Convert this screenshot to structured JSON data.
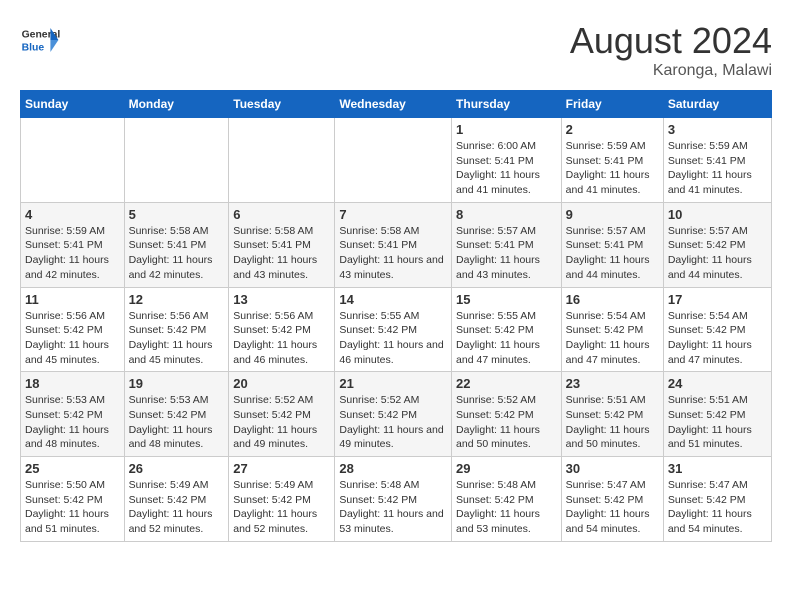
{
  "header": {
    "logo_line1": "General",
    "logo_line2": "Blue",
    "title": "August 2024",
    "subtitle": "Karonga, Malawi"
  },
  "days_of_week": [
    "Sunday",
    "Monday",
    "Tuesday",
    "Wednesday",
    "Thursday",
    "Friday",
    "Saturday"
  ],
  "weeks": [
    [
      {
        "day": "",
        "sunrise": "",
        "sunset": "",
        "daylight": ""
      },
      {
        "day": "",
        "sunrise": "",
        "sunset": "",
        "daylight": ""
      },
      {
        "day": "",
        "sunrise": "",
        "sunset": "",
        "daylight": ""
      },
      {
        "day": "",
        "sunrise": "",
        "sunset": "",
        "daylight": ""
      },
      {
        "day": "1",
        "sunrise": "Sunrise: 6:00 AM",
        "sunset": "Sunset: 5:41 PM",
        "daylight": "Daylight: 11 hours and 41 minutes."
      },
      {
        "day": "2",
        "sunrise": "Sunrise: 5:59 AM",
        "sunset": "Sunset: 5:41 PM",
        "daylight": "Daylight: 11 hours and 41 minutes."
      },
      {
        "day": "3",
        "sunrise": "Sunrise: 5:59 AM",
        "sunset": "Sunset: 5:41 PM",
        "daylight": "Daylight: 11 hours and 41 minutes."
      }
    ],
    [
      {
        "day": "4",
        "sunrise": "Sunrise: 5:59 AM",
        "sunset": "Sunset: 5:41 PM",
        "daylight": "Daylight: 11 hours and 42 minutes."
      },
      {
        "day": "5",
        "sunrise": "Sunrise: 5:58 AM",
        "sunset": "Sunset: 5:41 PM",
        "daylight": "Daylight: 11 hours and 42 minutes."
      },
      {
        "day": "6",
        "sunrise": "Sunrise: 5:58 AM",
        "sunset": "Sunset: 5:41 PM",
        "daylight": "Daylight: 11 hours and 43 minutes."
      },
      {
        "day": "7",
        "sunrise": "Sunrise: 5:58 AM",
        "sunset": "Sunset: 5:41 PM",
        "daylight": "Daylight: 11 hours and 43 minutes."
      },
      {
        "day": "8",
        "sunrise": "Sunrise: 5:57 AM",
        "sunset": "Sunset: 5:41 PM",
        "daylight": "Daylight: 11 hours and 43 minutes."
      },
      {
        "day": "9",
        "sunrise": "Sunrise: 5:57 AM",
        "sunset": "Sunset: 5:41 PM",
        "daylight": "Daylight: 11 hours and 44 minutes."
      },
      {
        "day": "10",
        "sunrise": "Sunrise: 5:57 AM",
        "sunset": "Sunset: 5:42 PM",
        "daylight": "Daylight: 11 hours and 44 minutes."
      }
    ],
    [
      {
        "day": "11",
        "sunrise": "Sunrise: 5:56 AM",
        "sunset": "Sunset: 5:42 PM",
        "daylight": "Daylight: 11 hours and 45 minutes."
      },
      {
        "day": "12",
        "sunrise": "Sunrise: 5:56 AM",
        "sunset": "Sunset: 5:42 PM",
        "daylight": "Daylight: 11 hours and 45 minutes."
      },
      {
        "day": "13",
        "sunrise": "Sunrise: 5:56 AM",
        "sunset": "Sunset: 5:42 PM",
        "daylight": "Daylight: 11 hours and 46 minutes."
      },
      {
        "day": "14",
        "sunrise": "Sunrise: 5:55 AM",
        "sunset": "Sunset: 5:42 PM",
        "daylight": "Daylight: 11 hours and 46 minutes."
      },
      {
        "day": "15",
        "sunrise": "Sunrise: 5:55 AM",
        "sunset": "Sunset: 5:42 PM",
        "daylight": "Daylight: 11 hours and 47 minutes."
      },
      {
        "day": "16",
        "sunrise": "Sunrise: 5:54 AM",
        "sunset": "Sunset: 5:42 PM",
        "daylight": "Daylight: 11 hours and 47 minutes."
      },
      {
        "day": "17",
        "sunrise": "Sunrise: 5:54 AM",
        "sunset": "Sunset: 5:42 PM",
        "daylight": "Daylight: 11 hours and 47 minutes."
      }
    ],
    [
      {
        "day": "18",
        "sunrise": "Sunrise: 5:53 AM",
        "sunset": "Sunset: 5:42 PM",
        "daylight": "Daylight: 11 hours and 48 minutes."
      },
      {
        "day": "19",
        "sunrise": "Sunrise: 5:53 AM",
        "sunset": "Sunset: 5:42 PM",
        "daylight": "Daylight: 11 hours and 48 minutes."
      },
      {
        "day": "20",
        "sunrise": "Sunrise: 5:52 AM",
        "sunset": "Sunset: 5:42 PM",
        "daylight": "Daylight: 11 hours and 49 minutes."
      },
      {
        "day": "21",
        "sunrise": "Sunrise: 5:52 AM",
        "sunset": "Sunset: 5:42 PM",
        "daylight": "Daylight: 11 hours and 49 minutes."
      },
      {
        "day": "22",
        "sunrise": "Sunrise: 5:52 AM",
        "sunset": "Sunset: 5:42 PM",
        "daylight": "Daylight: 11 hours and 50 minutes."
      },
      {
        "day": "23",
        "sunrise": "Sunrise: 5:51 AM",
        "sunset": "Sunset: 5:42 PM",
        "daylight": "Daylight: 11 hours and 50 minutes."
      },
      {
        "day": "24",
        "sunrise": "Sunrise: 5:51 AM",
        "sunset": "Sunset: 5:42 PM",
        "daylight": "Daylight: 11 hours and 51 minutes."
      }
    ],
    [
      {
        "day": "25",
        "sunrise": "Sunrise: 5:50 AM",
        "sunset": "Sunset: 5:42 PM",
        "daylight": "Daylight: 11 hours and 51 minutes."
      },
      {
        "day": "26",
        "sunrise": "Sunrise: 5:49 AM",
        "sunset": "Sunset: 5:42 PM",
        "daylight": "Daylight: 11 hours and 52 minutes."
      },
      {
        "day": "27",
        "sunrise": "Sunrise: 5:49 AM",
        "sunset": "Sunset: 5:42 PM",
        "daylight": "Daylight: 11 hours and 52 minutes."
      },
      {
        "day": "28",
        "sunrise": "Sunrise: 5:48 AM",
        "sunset": "Sunset: 5:42 PM",
        "daylight": "Daylight: 11 hours and 53 minutes."
      },
      {
        "day": "29",
        "sunrise": "Sunrise: 5:48 AM",
        "sunset": "Sunset: 5:42 PM",
        "daylight": "Daylight: 11 hours and 53 minutes."
      },
      {
        "day": "30",
        "sunrise": "Sunrise: 5:47 AM",
        "sunset": "Sunset: 5:42 PM",
        "daylight": "Daylight: 11 hours and 54 minutes."
      },
      {
        "day": "31",
        "sunrise": "Sunrise: 5:47 AM",
        "sunset": "Sunset: 5:42 PM",
        "daylight": "Daylight: 11 hours and 54 minutes."
      }
    ]
  ]
}
